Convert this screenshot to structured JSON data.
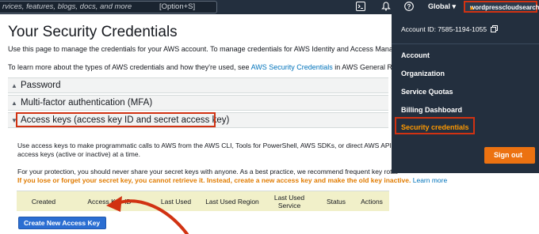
{
  "topbar": {
    "search_placeholder": "rvices, features, blogs, docs, and more",
    "search_shortcut": "[Option+S]",
    "region_label": "Global",
    "account_label": "wordpresscloudsearch"
  },
  "page": {
    "title": "Your Security Credentials",
    "intro": "Use this page to manage the credentials for your AWS account. To manage credentials for AWS Identity and Access Management (",
    "learn_text": "To learn more about the types of AWS credentials and how they're used, see ",
    "learn_link": "AWS Security Credentials",
    "learn_suffix": " in AWS General Reference."
  },
  "sections": [
    {
      "label": "Password",
      "expanded": false
    },
    {
      "label": "Multi-factor authentication (MFA)",
      "expanded": false
    },
    {
      "label": "Access keys (access key ID and secret access key)",
      "expanded": true
    }
  ],
  "access_keys": {
    "desc_line1": "Use access keys to make programmatic calls to AWS from the AWS CLI, Tools for PowerShell, AWS SDKs, or direct AWS API ca",
    "desc_line2": "access keys (active or inactive) at a time.",
    "protect_text": "For your protection, you should never share your secret keys with anyone. As a best practice, we recommend frequent key rotat",
    "warning_text": "If you lose or forget your secret key, you cannot retrieve it. Instead, create a new access key and make the old key inactive.",
    "learn_more": "Learn more",
    "columns": [
      "Created",
      "Access Key ID",
      "Last Used",
      "Last Used Region",
      "Last Used Service",
      "Status",
      "Actions"
    ],
    "create_button": "Create New Access Key"
  },
  "account_menu": {
    "account_id": "Account ID: 7585-1194-1055",
    "items": [
      "Account",
      "Organization",
      "Service Quotas",
      "Billing Dashboard",
      "Security credentials"
    ],
    "active_item": "Security credentials",
    "sign_out": "Sign out"
  },
  "colors": {
    "topbar": "#232f3e",
    "accent_orange": "#ec7211",
    "highlight_red": "#d13212",
    "link_blue": "#0073bb",
    "button_blue": "#2b6ed2"
  }
}
